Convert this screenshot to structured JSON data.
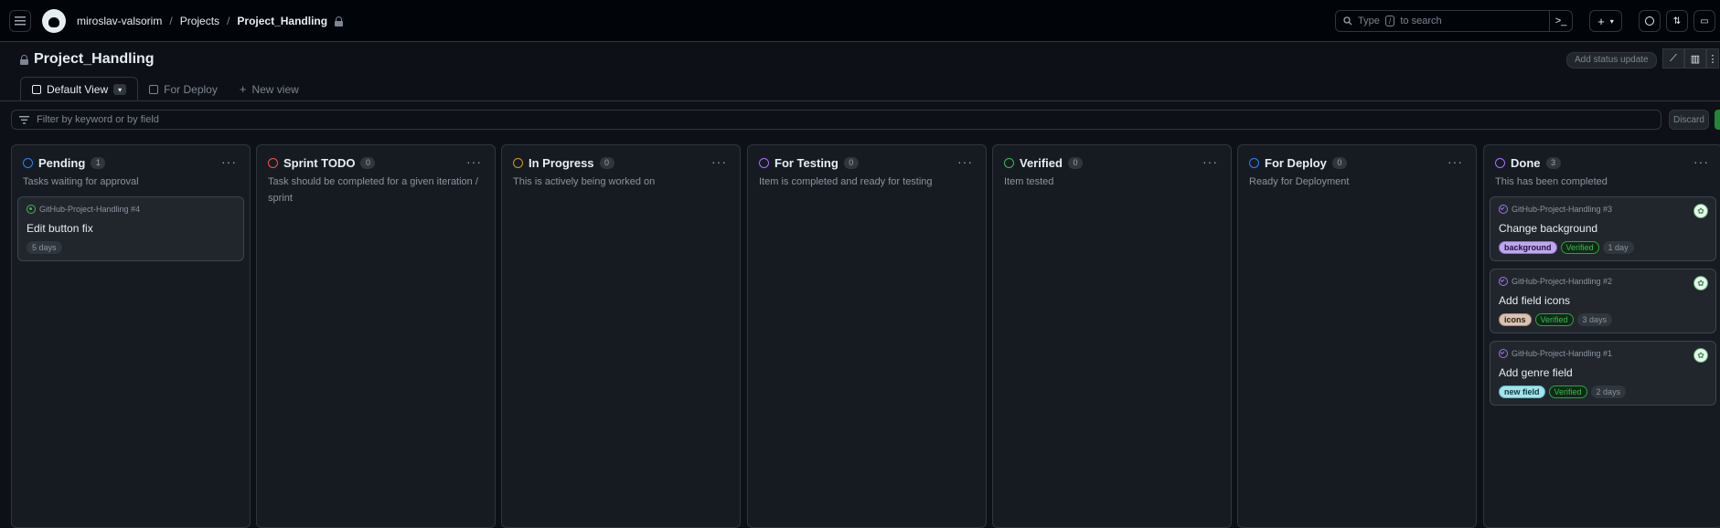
{
  "header": {
    "user": "miroslav-valsorim",
    "projects": "Projects",
    "project": "Project_Handling",
    "search_placeholder_pre": "Type",
    "search_key": "/",
    "search_placeholder_post": "to search"
  },
  "project": {
    "title": "Project_Handling",
    "status_update_label": "Add status update"
  },
  "tabs": [
    {
      "label": "Default View",
      "active": true
    },
    {
      "label": "For Deploy",
      "active": false
    },
    {
      "label": "New view",
      "active": false
    }
  ],
  "filter": {
    "placeholder": "Filter by keyword or by field",
    "discard_label": "Discard"
  },
  "columns": [
    {
      "name": "Pending",
      "count": "1",
      "desc": "Tasks waiting for approval",
      "color": "#2f81f7"
    },
    {
      "name": "Sprint TODO",
      "count": "0",
      "desc": "Task should be completed for a given iteration / sprint",
      "color": "#f85149"
    },
    {
      "name": "In Progress",
      "count": "0",
      "desc": "This is actively being worked on",
      "color": "#d29922"
    },
    {
      "name": "For Testing",
      "count": "0",
      "desc": "Item is completed and ready for testing",
      "color": "#a371f7"
    },
    {
      "name": "Verified",
      "count": "0",
      "desc": "Item tested",
      "color": "#3fb950"
    },
    {
      "name": "For Deploy",
      "count": "0",
      "desc": "Ready for Deployment",
      "color": "#2f81f7"
    },
    {
      "name": "Done",
      "count": "3",
      "desc": "This has been completed",
      "color": "#a371f7"
    }
  ],
  "cards": {
    "pending_1": {
      "ref": "GitHub-Project-Handling #4",
      "title": "Edit button fix",
      "time": "5 days"
    },
    "done_1": {
      "ref": "GitHub-Project-Handling #3",
      "title": "Change background",
      "label": "background",
      "status": "Verified",
      "time": "1 day"
    },
    "done_2": {
      "ref": "GitHub-Project-Handling #2",
      "title": "Add field icons",
      "label": "icons",
      "status": "Verified",
      "time": "3 days"
    },
    "done_3": {
      "ref": "GitHub-Project-Handling #1",
      "title": "Add genre field",
      "label": "new field",
      "status": "Verified",
      "time": "2 days"
    }
  }
}
